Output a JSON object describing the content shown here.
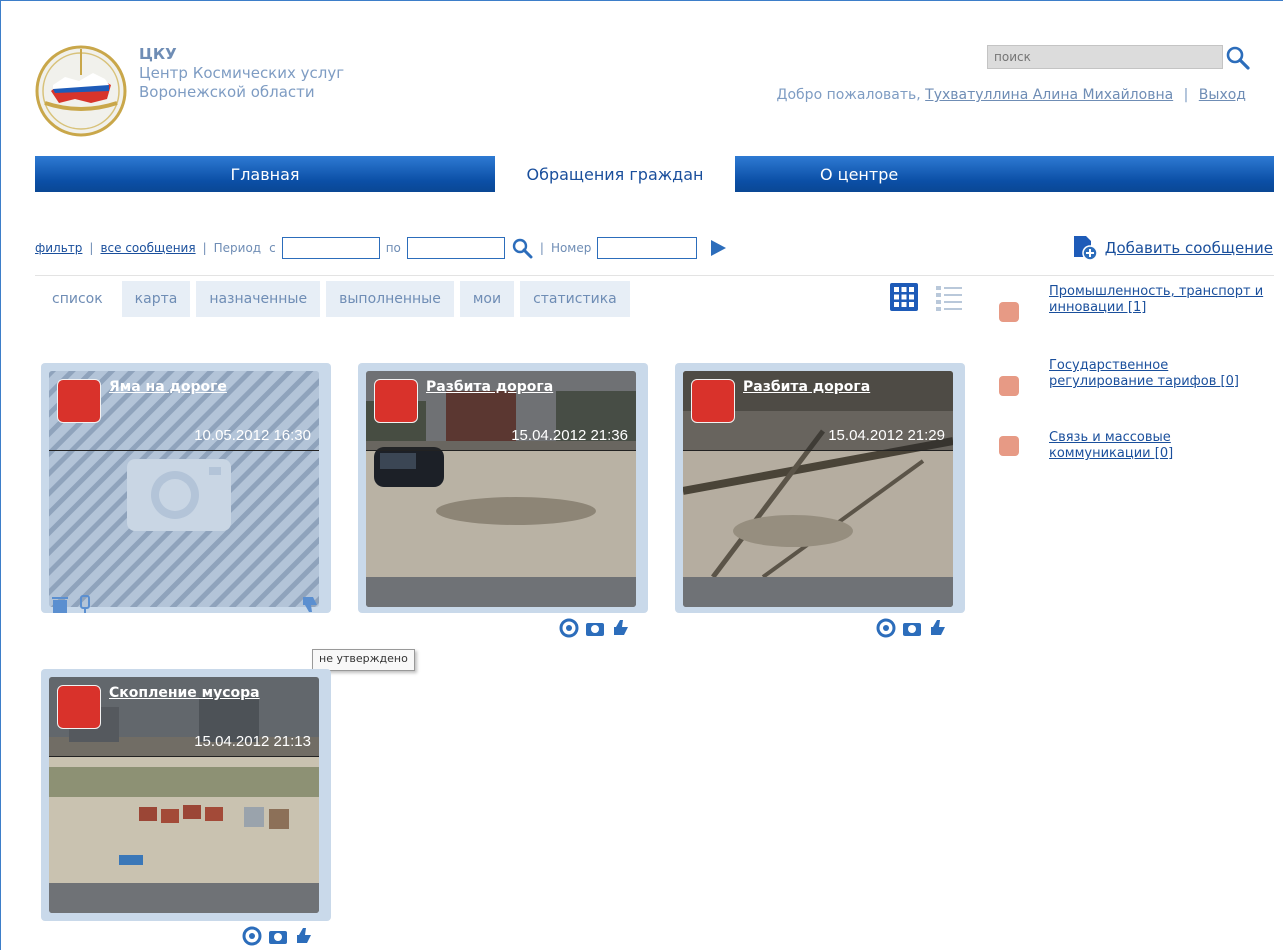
{
  "brand": {
    "abbr": "ЦКУ",
    "line1": "Центр Космических услуг",
    "line2": "Воронежской области"
  },
  "search": {
    "placeholder": "поиск"
  },
  "welcome": {
    "greeting": "Добро пожаловать,",
    "user": "Тухватуллина Алина Михайловна",
    "logout": "Выход"
  },
  "nav": [
    {
      "label": "Главная"
    },
    {
      "label": "Обращения граждан"
    },
    {
      "label": "О центре"
    }
  ],
  "toolbar": {
    "filter": "фильтр",
    "all_messages": "все сообщения",
    "period": "Период",
    "from": "с",
    "to": "по",
    "number": "Номер",
    "add_message": "Добавить сообщение"
  },
  "tabs": [
    {
      "label": "список"
    },
    {
      "label": "карта"
    },
    {
      "label": "назначенные"
    },
    {
      "label": "выполненные"
    },
    {
      "label": "мои"
    },
    {
      "label": "статистика"
    }
  ],
  "categories": [
    {
      "label": "Промышленность, транспорт и инновации [1]"
    },
    {
      "label": "Государственное регулирование тарифов [0]"
    },
    {
      "label": "Связь и массовые коммуникации [0]"
    }
  ],
  "cards": [
    {
      "title": "Яма на дороге",
      "date": "10.05.2012 16:30"
    },
    {
      "title": "Разбита дорога",
      "date": "15.04.2012 21:36"
    },
    {
      "title": "Разбита дорога",
      "date": "15.04.2012 21:29"
    },
    {
      "title": "Скопление мусора",
      "date": "15.04.2012 21:13"
    }
  ],
  "tooltip": "не утверждено",
  "colors": {
    "nav_blue": "#0b4fa6",
    "badge_red": "#d9322b",
    "card_border": "#c9d9ea"
  }
}
